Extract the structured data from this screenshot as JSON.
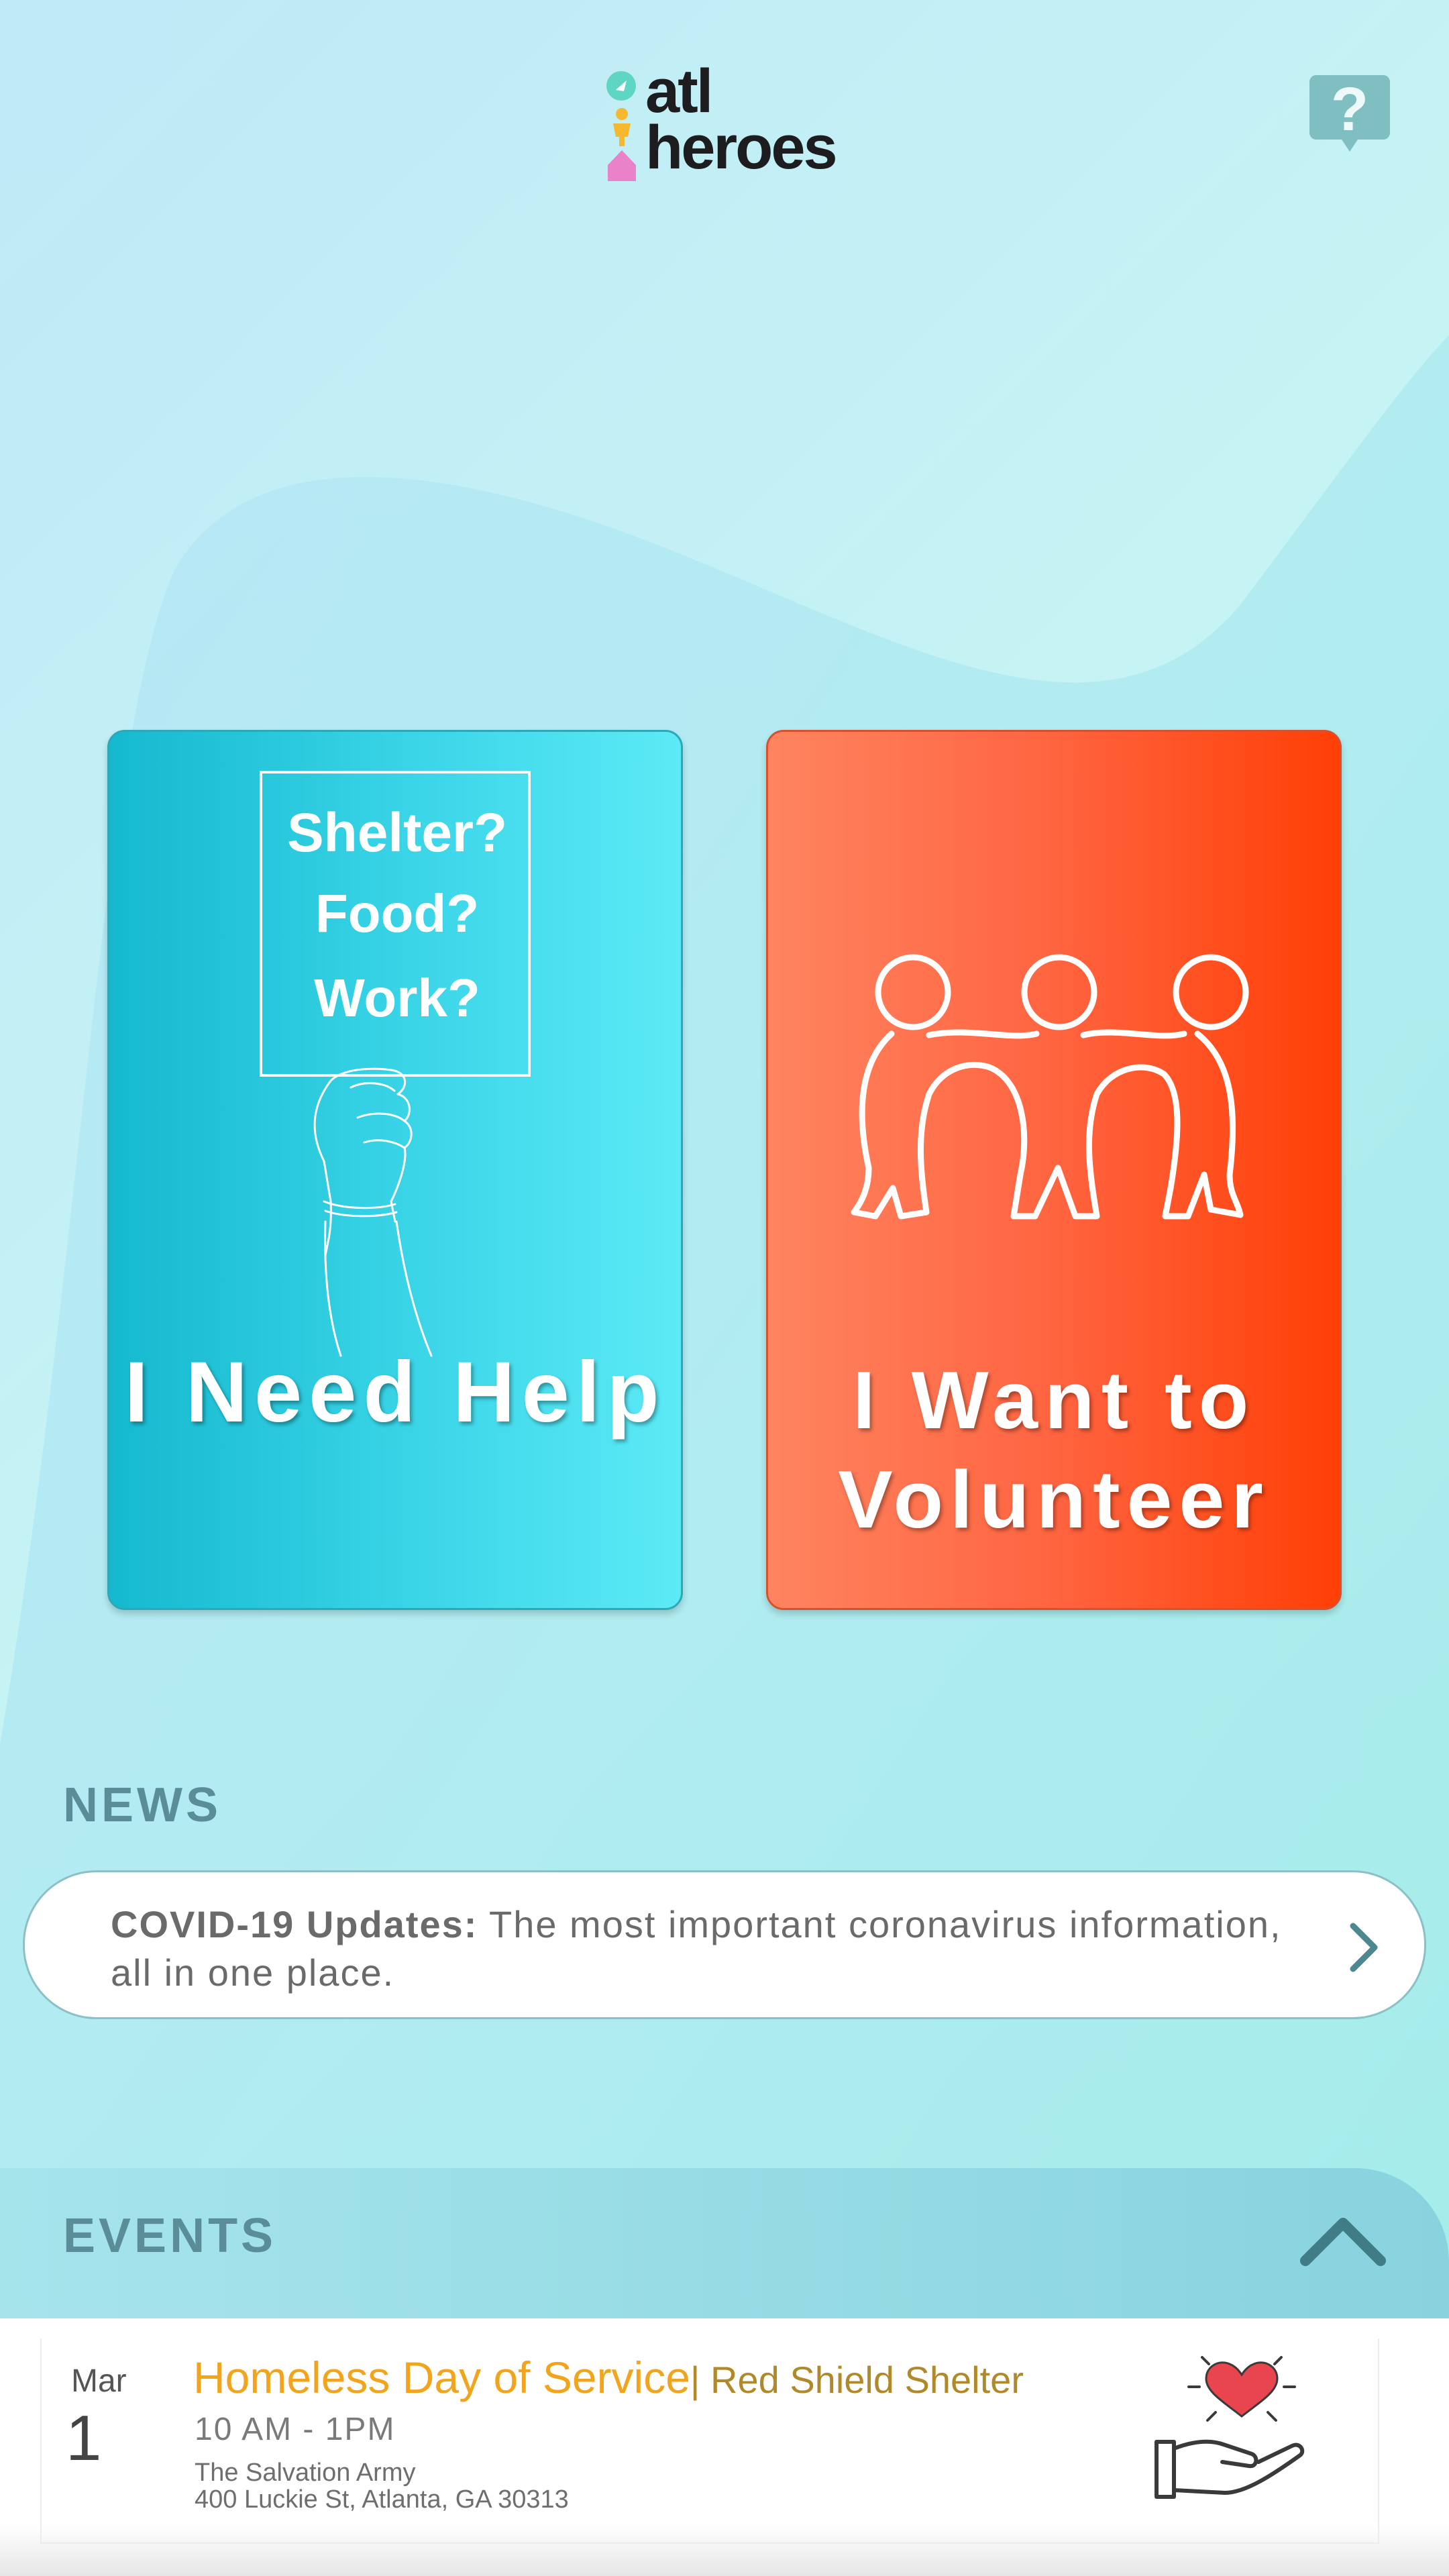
{
  "app": {
    "logo_line1": "atl",
    "logo_line2": "heroes",
    "help_icon": "question-bubble-icon"
  },
  "cards": {
    "help": {
      "title": "I Need Help",
      "sign_lines": [
        "Shelter?",
        "Food?",
        "Work?"
      ],
      "illustration": "hand-holding-sign-icon"
    },
    "volunteer": {
      "title": "I Want to\nVolunteer",
      "illustration": "three-people-arms-linked-icon"
    }
  },
  "news": {
    "heading": "NEWS",
    "item_bold": "COVID-19 Updates:",
    "item_text": " The most important coronavirus information, all in one place.",
    "chevron": "chevron-right-icon"
  },
  "events": {
    "heading": "EVENTS",
    "toggle_icon": "chevron-up-icon",
    "items": [
      {
        "month": "Mar",
        "day": "1",
        "title": "Homeless Day of Service",
        "venue": "| Red Shield Shelter",
        "time": "10 AM - 1PM",
        "organization": "The Salvation Army",
        "address": "400 Luckie St, Atlanta, GA 30313",
        "icon": "heart-in-hand-icon"
      }
    ]
  },
  "colors": {
    "help_card": "#2cc9de",
    "volunteer_card": "#ff5a2a",
    "heading": "#5a8d97",
    "event_title": "#f2a51c"
  }
}
